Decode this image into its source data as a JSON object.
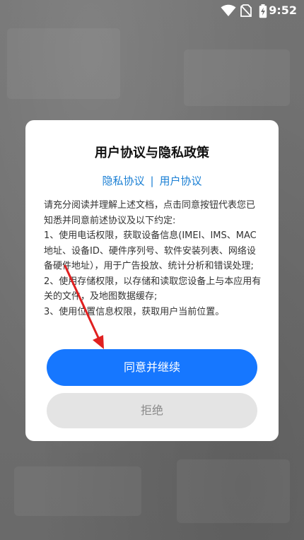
{
  "status_bar": {
    "time": "9:52",
    "icons": [
      "wifi-icon",
      "no-sim-icon",
      "battery-charging-icon"
    ]
  },
  "dialog": {
    "title": "用户协议与隐私政策",
    "links": {
      "privacy": "隐私协议",
      "separator": "|",
      "user_agreement": "用户协议"
    },
    "paragraphs": [
      "请充分阅读并理解上述文档，点击同意按钮代表您已知悉并同意前述协议及以下约定:",
      "1、使用电话权限，获取设备信息(IMEI、IMS、MAC地址、设备ID、硬件序列号、软件安装列表、网络设备硬件地址），用于广告投放、统计分析和错误处理;",
      "2、使用存储权限，以存储和读取您设备上与本应用有关的文件，及地图数据缓存;",
      "3、使用位置信息权限，获取用户当前位置。"
    ],
    "agree_label": "同意并继续",
    "reject_label": "拒绝"
  },
  "colors": {
    "primary": "#1677ff",
    "link": "#1a7fd4",
    "reject_bg": "#e4e4e4",
    "annotation_arrow": "#e02020"
  }
}
